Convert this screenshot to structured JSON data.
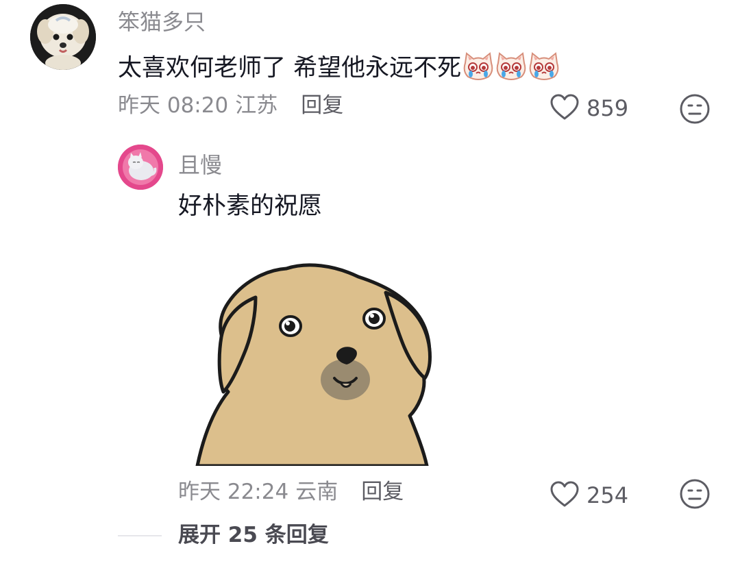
{
  "comment": {
    "username": "笨猫多只",
    "text": "太喜欢何老师了 希望他永远不死",
    "emojis": [
      "crying-cat-emoji",
      "crying-cat-emoji",
      "crying-cat-emoji"
    ],
    "time": "昨天 08:20",
    "location": "江苏",
    "reply_label": "回复",
    "likes": "859"
  },
  "reply": {
    "username": "且慢",
    "text": "好朴素的祝愿",
    "sticker": "dog-sticker",
    "time": "昨天 22:24",
    "location": "云南",
    "reply_label": "回复",
    "likes": "254"
  },
  "expand_label": "展开 25 条回复",
  "icons": {
    "like": "heart-outline-icon",
    "dislike": "neutral-face-icon"
  },
  "colors": {
    "secondary_text": "#8a8a8f",
    "primary_text": "#161823",
    "dog_fill": "#dcbf8c"
  }
}
